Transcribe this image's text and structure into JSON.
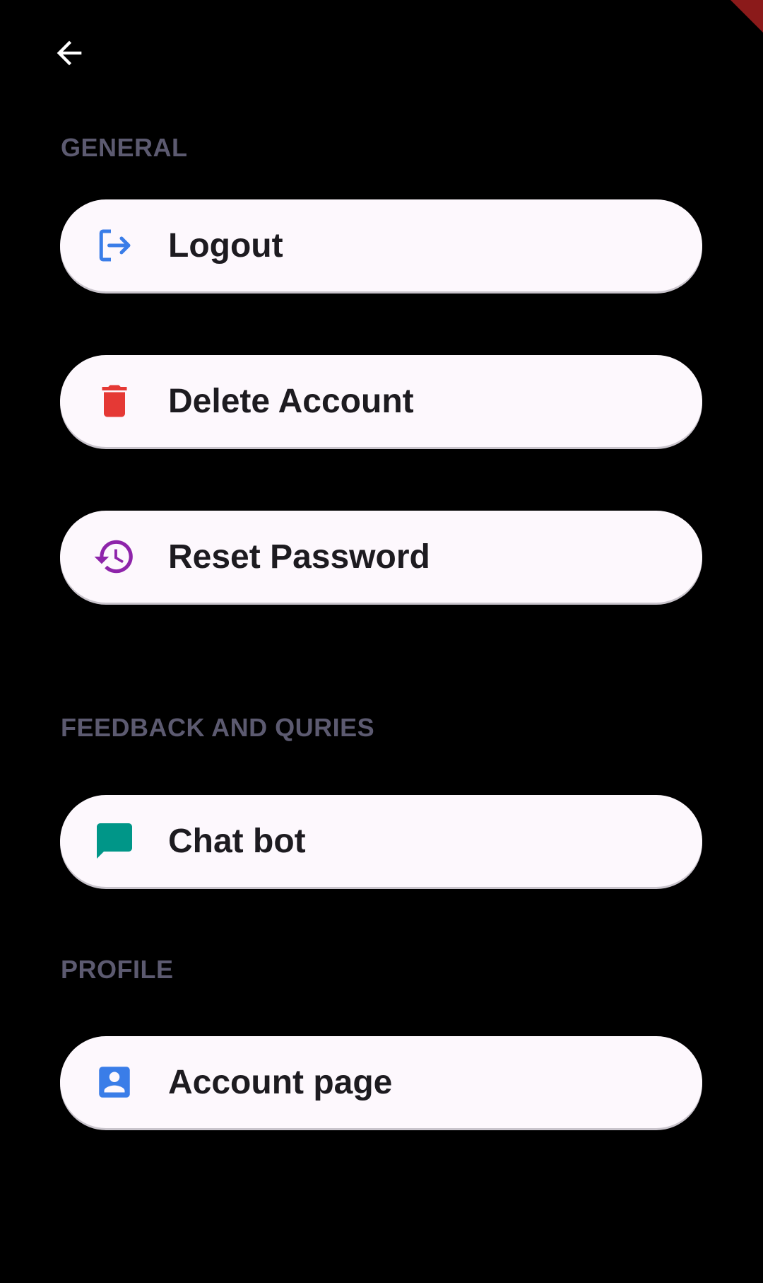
{
  "sections": {
    "general": "GENERAL",
    "feedback": "FEEDBACK AND QURIES",
    "profile": "PROFILE"
  },
  "items": {
    "logout": "Logout",
    "delete_account": "Delete Account",
    "reset_password": "Reset Password",
    "chat_bot": "Chat bot",
    "account_page": "Account page"
  },
  "icons": {
    "back": "arrow-back-icon",
    "logout": "logout-icon",
    "delete_account": "trash-icon",
    "reset_password": "history-icon",
    "chat_bot": "chat-bubble-icon",
    "account_page": "account-box-icon"
  },
  "colors": {
    "background": "#000000",
    "tile": "#fdf8fd",
    "section_header": "#5c5a70",
    "label": "#1d1b20",
    "logout_icon": "#3a7de8",
    "delete_icon": "#e53935",
    "reset_icon": "#8e24aa",
    "chat_icon": "#009688",
    "account_icon": "#3a7de8"
  }
}
